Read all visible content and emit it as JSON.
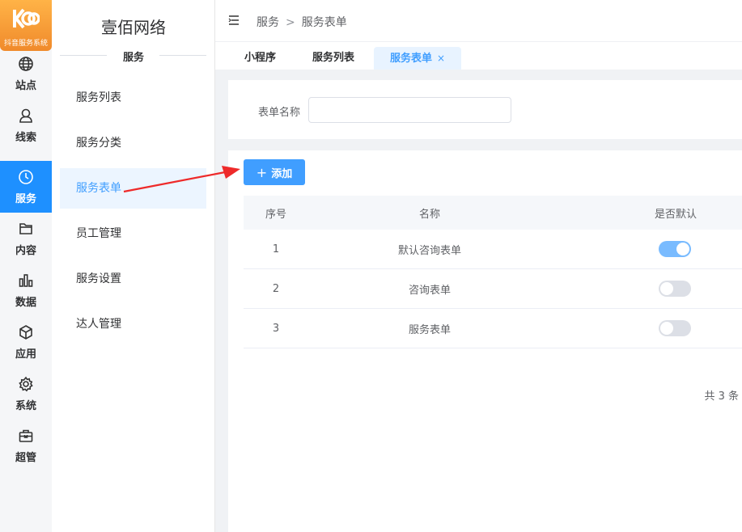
{
  "logo": {
    "text": "抖音服务系统"
  },
  "rail": {
    "items": [
      {
        "label": "站点",
        "icon": "globe-icon"
      },
      {
        "label": "线索",
        "icon": "user-icon"
      },
      {
        "label": "服务",
        "icon": "clock-icon",
        "active": true
      },
      {
        "label": "内容",
        "icon": "folder-icon"
      },
      {
        "label": "数据",
        "icon": "bar-chart-icon"
      },
      {
        "label": "应用",
        "icon": "cube-icon"
      },
      {
        "label": "系统",
        "icon": "gear-icon"
      },
      {
        "label": "超管",
        "icon": "toolbox-icon"
      }
    ]
  },
  "submenu": {
    "brand": "壹佰网络",
    "section": "服务",
    "items": [
      {
        "label": "服务列表"
      },
      {
        "label": "服务分类"
      },
      {
        "label": "服务表单",
        "active": true
      },
      {
        "label": "员工管理"
      },
      {
        "label": "服务设置"
      },
      {
        "label": "达人管理"
      }
    ]
  },
  "header": {
    "breadcrumb": [
      "服务",
      "服务表单"
    ],
    "separator": ">"
  },
  "tabs": [
    {
      "label": "小程序"
    },
    {
      "label": "服务列表"
    },
    {
      "label": "服务表单",
      "active": true,
      "close": "×"
    }
  ],
  "search": {
    "label": "表单名称",
    "value": "",
    "placeholder": ""
  },
  "toolbar": {
    "add_label": "添加",
    "add_icon": "+"
  },
  "table": {
    "headers": [
      "序号",
      "名称",
      "是否默认"
    ],
    "rows": [
      {
        "index": "1",
        "name": "默认咨询表单",
        "default": true
      },
      {
        "index": "2",
        "name": "咨询表单",
        "default": false
      },
      {
        "index": "3",
        "name": "服务表单",
        "default": false
      }
    ]
  },
  "pagination": {
    "total_text": "共 3 条"
  },
  "colors": {
    "accent": "#409eff",
    "rail_active": "#1e90ff",
    "logo": "#f08a2b",
    "arrow": "#ee2a2a"
  }
}
